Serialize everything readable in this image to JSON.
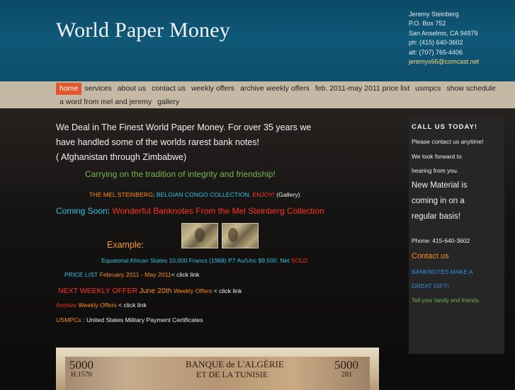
{
  "header": {
    "site_title": "World Paper Money",
    "contact": {
      "name": "Jeremy Steinberg",
      "address1": "P.O. Box 752",
      "address2": "San Anselmo, CA 94979",
      "phone": "ph: (415) 640-3602",
      "alt": "alt: (707) 765-4406",
      "email": "jeremys66@comcast.net"
    }
  },
  "nav": {
    "row1": [
      "home",
      "services",
      "about us",
      "contact us",
      "weekly offers",
      "archive weekly offers",
      "feb. 2011-may 2011 price list",
      "usmpcs",
      "show schedule"
    ],
    "row2": [
      "a word from mel and jeremy",
      "gallery"
    ]
  },
  "main": {
    "intro_line1": "We Deal in The Finest World Paper Money.  For over 35 years we",
    "intro_line2": "have handled some of the worlds rarest bank notes!",
    "intro_line3": "( Afghanistan through Zimbabwe)",
    "tradition": "Carrying on the tradition of integrity and friendship!",
    "mel_label": "THE MEL STEINBERG",
    "mel_sep": ":  ",
    "mel_collection": "BELGIAN CONGO COLLECTION.",
    "mel_enjoy": "ENJOY!",
    "mel_gallery": "(Gallery)",
    "coming_label": "Coming Soon",
    "coming_sep": ": ",
    "coming_text": "Wonderful Banknotes From the Mel Steinberg Collection",
    "example_label": "Example:",
    "equatorial_text": "Equatorial African States 10,000 Francs (1968) P7  Au/Unc $9,500. Net",
    "equatorial_sold": "SOLD",
    "pricelist_label": "PRICE LIST",
    "pricelist_period": "February 2011 - May 2011",
    "pricelist_click": "< click link",
    "next_label": "NEXT WEEKLY OFFER",
    "next_date": "June 20th",
    "next_link": "Weekly Offers",
    "next_click": "< click link",
    "archive_label": "Archive",
    "archive_link": "Weekly Offers",
    "archive_click": "< click link",
    "usmpc_label": "USMPCs",
    "usmpc_text": ": United States Military Payment Certificates"
  },
  "banknote": {
    "value_left": "5000",
    "serial": "H.1570",
    "bank_line1": "BANQUE de L'ALGÉRIE",
    "bank_line2": "ET DE LA TUNISIE",
    "value_right": "5000",
    "serial_right": "281"
  },
  "sidebar": {
    "call": "CALL US TODAY!",
    "line1": "Please contact us anytime!",
    "line2": "We look forward to",
    "line3": "hearing from you.",
    "new1": "New Material is",
    "new2": "coming in on a",
    "new3": "regular basis!",
    "phone": "Phone: 415-640-3602",
    "contact_link": "Contact us",
    "gift1": "BANKNOTES MAKE A",
    "gift2": "GREAT GIFT!",
    "tell": "Tell your family and friends."
  },
  "colors": {
    "header_blue": "#0f5877",
    "nav_tan": "#c5b9a5",
    "active_orange": "#e2582c",
    "text_orange": "#ff8c1a",
    "text_red": "#ff3322",
    "text_cyan": "#30c3e6",
    "text_green": "#74b74a"
  }
}
